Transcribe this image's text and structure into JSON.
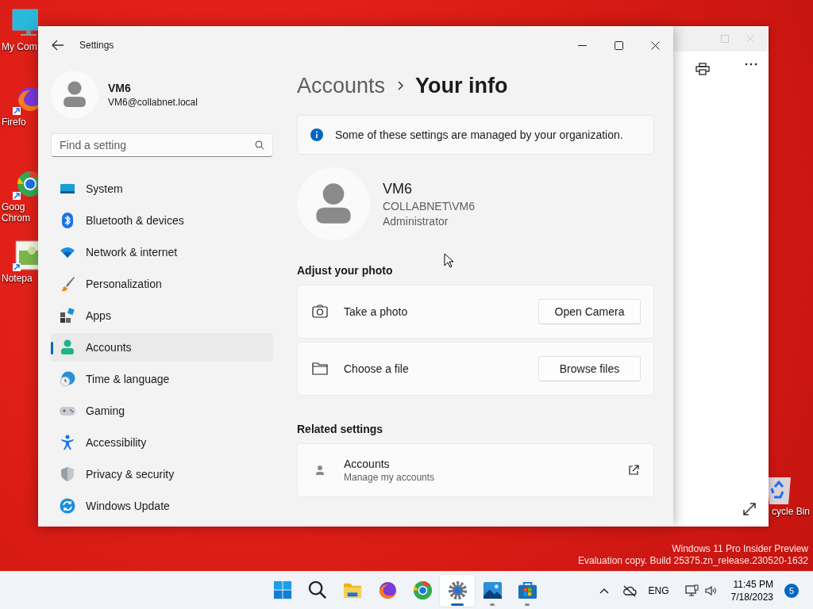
{
  "desktop": {
    "icons": [
      {
        "kind": "computer",
        "lines": [
          "My Com"
        ]
      },
      {
        "kind": "firefox",
        "lines": [
          "Firefo"
        ]
      },
      {
        "kind": "chrome",
        "lines": [
          "Goog",
          "Chrom"
        ]
      },
      {
        "kind": "notepad",
        "lines": [
          "Notepa"
        ]
      },
      {
        "kind": "recycle",
        "lines": [
          "cycle Bin"
        ]
      }
    ],
    "watermark": [
      "Windows 11 Pro Insider Preview",
      "Evaluation copy. Build 25375.zn_release.230520-1632"
    ]
  },
  "settings": {
    "title": "Settings",
    "user": {
      "name": "VM6",
      "email": "VM6@collabnet.local"
    },
    "search": {
      "placeholder": "Find a setting"
    },
    "nav": [
      {
        "label": "System",
        "kind": "system",
        "selected": false
      },
      {
        "label": "Bluetooth & devices",
        "kind": "bluetooth",
        "selected": false
      },
      {
        "label": "Network & internet",
        "kind": "network",
        "selected": false
      },
      {
        "label": "Personalization",
        "kind": "brush",
        "selected": false
      },
      {
        "label": "Apps",
        "kind": "apps",
        "selected": false
      },
      {
        "label": "Accounts",
        "kind": "accounts",
        "selected": true
      },
      {
        "label": "Time & language",
        "kind": "time",
        "selected": false
      },
      {
        "label": "Gaming",
        "kind": "gaming",
        "selected": false
      },
      {
        "label": "Accessibility",
        "kind": "accessibility",
        "selected": false
      },
      {
        "label": "Privacy & security",
        "kind": "shield",
        "selected": false
      },
      {
        "label": "Windows Update",
        "kind": "update",
        "selected": false
      }
    ],
    "breadcrumb": [
      "Accounts",
      "Your info"
    ],
    "banner": "Some of these settings are managed by your organization.",
    "profile": {
      "name": "VM6",
      "domain": "COLLABNET\\VM6",
      "role": "Administrator"
    },
    "sections": [
      {
        "title": "Adjust your photo",
        "cards": [
          {
            "kind": "camera",
            "label": "Take a photo",
            "button": "Open Camera"
          },
          {
            "kind": "folder",
            "label": "Choose a file",
            "button": "Browse files"
          }
        ]
      },
      {
        "title": "Related settings",
        "cards": [
          {
            "kind": "link",
            "label": "Accounts",
            "sublabel": "Manage my accounts"
          }
        ]
      }
    ]
  },
  "taskbar": {
    "apps": [
      {
        "kind": "start",
        "selected": false,
        "running": false
      },
      {
        "kind": "search",
        "selected": false,
        "running": false
      },
      {
        "kind": "explorer",
        "selected": false,
        "running": false
      },
      {
        "kind": "firefox",
        "selected": false,
        "running": false
      },
      {
        "kind": "chrome",
        "selected": false,
        "running": false
      },
      {
        "kind": "settings",
        "selected": true,
        "running": true
      },
      {
        "kind": "photos",
        "selected": false,
        "running": true
      },
      {
        "kind": "store",
        "selected": false,
        "running": true
      }
    ],
    "language": "ENG",
    "time": "11:45 PM",
    "date": "7/18/2023",
    "badge": "5"
  }
}
